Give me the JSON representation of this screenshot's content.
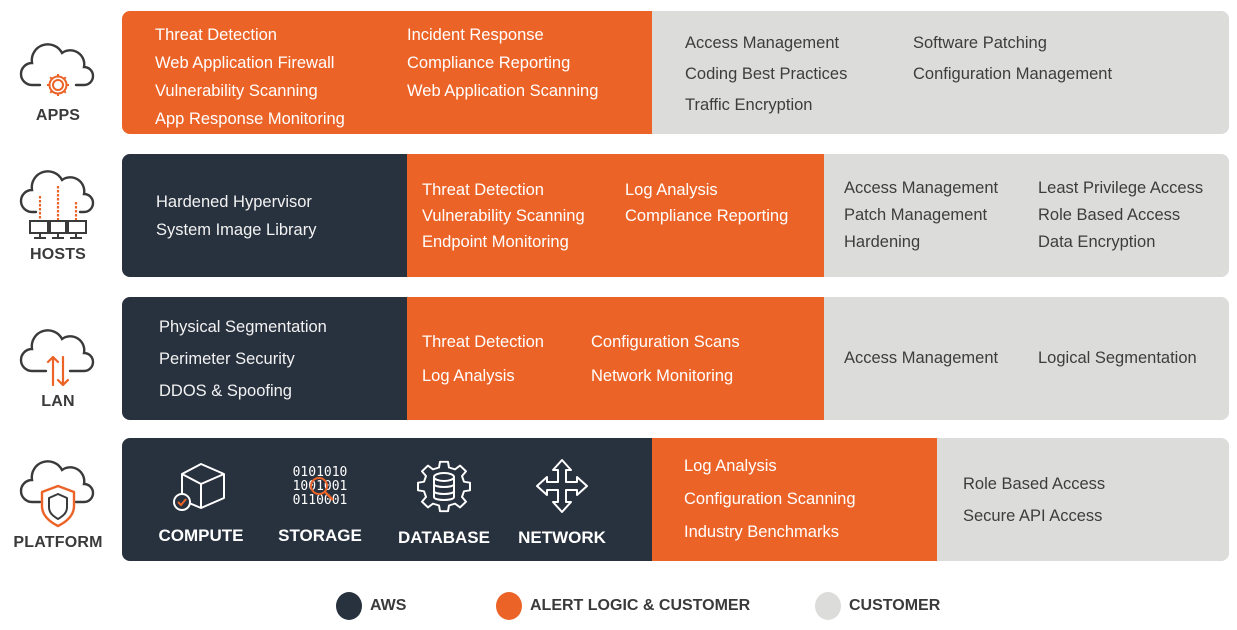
{
  "colors": {
    "aws": "#28313e",
    "alert_logic_and_customer": "#ec6327",
    "customer": "#dcdcda",
    "label_text": "#3a3a3a"
  },
  "layers": {
    "apps": {
      "label": "APPS",
      "icon": "cloud-gear-icon",
      "aws": [],
      "alert_logic": [
        [
          "Threat Detection",
          "Web Application Firewall",
          "Vulnerability Scanning",
          "App Response Monitoring"
        ],
        [
          "Incident Response",
          "Compliance Reporting",
          "Web Application Scanning"
        ]
      ],
      "customer": [
        [
          "Access Management",
          "Coding Best Practices",
          "Traffic Encryption"
        ],
        [
          "Software Patching",
          "Configuration Management"
        ]
      ]
    },
    "hosts": {
      "label": "HOSTS",
      "icon": "cloud-servers-icon",
      "aws": [
        [
          "Hardened Hypervisor",
          "System Image Library"
        ]
      ],
      "alert_logic": [
        [
          "Threat Detection",
          "Vulnerability Scanning",
          "Endpoint Monitoring"
        ],
        [
          "Log Analysis",
          "Compliance Reporting"
        ]
      ],
      "customer": [
        [
          "Access Management",
          "Patch Management",
          "Hardening"
        ],
        [
          "Least Privilege Access",
          "Role Based Access",
          "Data Encryption"
        ]
      ]
    },
    "lan": {
      "label": "LAN",
      "icon": "cloud-transfer-icon",
      "aws": [
        [
          "Physical Segmentation",
          "Perimeter Security",
          "DDOS & Spoofing"
        ]
      ],
      "alert_logic": [
        [
          "Threat Detection",
          "Log Analysis"
        ],
        [
          "Configuration Scans",
          "Network Monitoring"
        ]
      ],
      "customer": [
        [
          "Access Management"
        ],
        [
          "Logical Segmentation"
        ]
      ]
    },
    "platform": {
      "label": "PLATFORM",
      "icon": "cloud-shield-icon",
      "aws_services": [
        {
          "label": "COMPUTE",
          "icon": "cube-check-icon"
        },
        {
          "label": "STORAGE",
          "icon": "binary-search-icon"
        },
        {
          "label": "DATABASE",
          "icon": "gear-database-icon"
        },
        {
          "label": "NETWORK",
          "icon": "four-way-arrows-icon"
        }
      ],
      "alert_logic": [
        [
          "Log Analysis",
          "Configuration Scanning",
          "Industry Benchmarks"
        ]
      ],
      "customer": [
        [
          "Role Based Access",
          "Secure API Access"
        ]
      ]
    }
  },
  "legend": [
    {
      "label": "AWS",
      "color": "#28313e"
    },
    {
      "label": "ALERT LOGIC & CUSTOMER",
      "color": "#ec6327"
    },
    {
      "label": "CUSTOMER",
      "color": "#dcdcda"
    }
  ]
}
